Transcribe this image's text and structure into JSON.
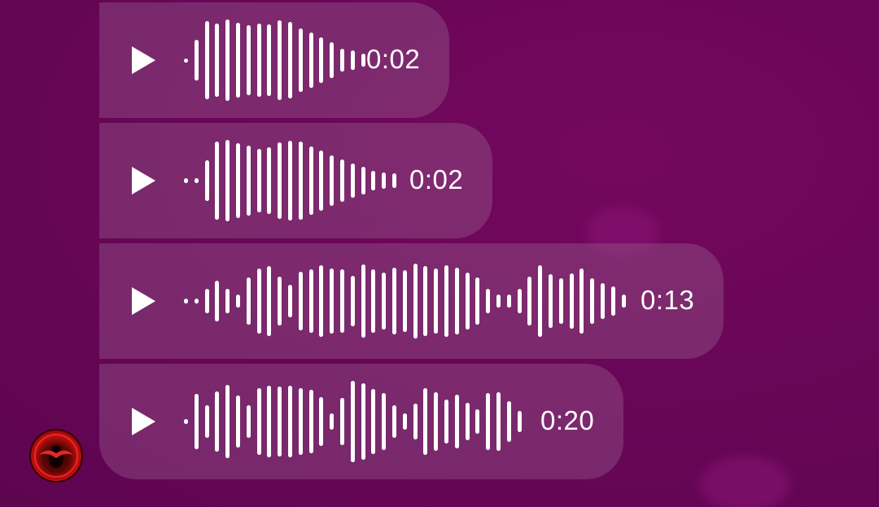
{
  "messages": [
    {
      "duration": "0:02",
      "bars": [
        4,
        50,
        96,
        90,
        100,
        92,
        86,
        90,
        88,
        98,
        94,
        78,
        68,
        56,
        44,
        28,
        24,
        16
      ]
    },
    {
      "duration": "0:02",
      "bars": [
        6,
        6,
        50,
        96,
        100,
        92,
        86,
        78,
        82,
        94,
        98,
        96,
        84,
        74,
        62,
        52,
        42,
        34,
        24,
        20,
        18
      ]
    },
    {
      "duration": "0:13",
      "bars": [
        6,
        6,
        30,
        50,
        30,
        16,
        58,
        80,
        86,
        60,
        40,
        72,
        78,
        88,
        80,
        78,
        62,
        90,
        78,
        70,
        82,
        76,
        92,
        86,
        80,
        88,
        82,
        70,
        58,
        30,
        16,
        16,
        30,
        60,
        88,
        66,
        56,
        68,
        80,
        56,
        44,
        36,
        16
      ]
    },
    {
      "duration": "0:20",
      "bars": [
        6,
        68,
        40,
        74,
        90,
        64,
        40,
        82,
        88,
        86,
        88,
        82,
        78,
        60,
        20,
        58,
        100,
        94,
        80,
        70,
        40,
        20,
        44,
        82,
        72,
        54,
        66,
        46,
        30,
        70,
        72,
        50,
        26
      ]
    }
  ],
  "avatar_name": "avatar"
}
